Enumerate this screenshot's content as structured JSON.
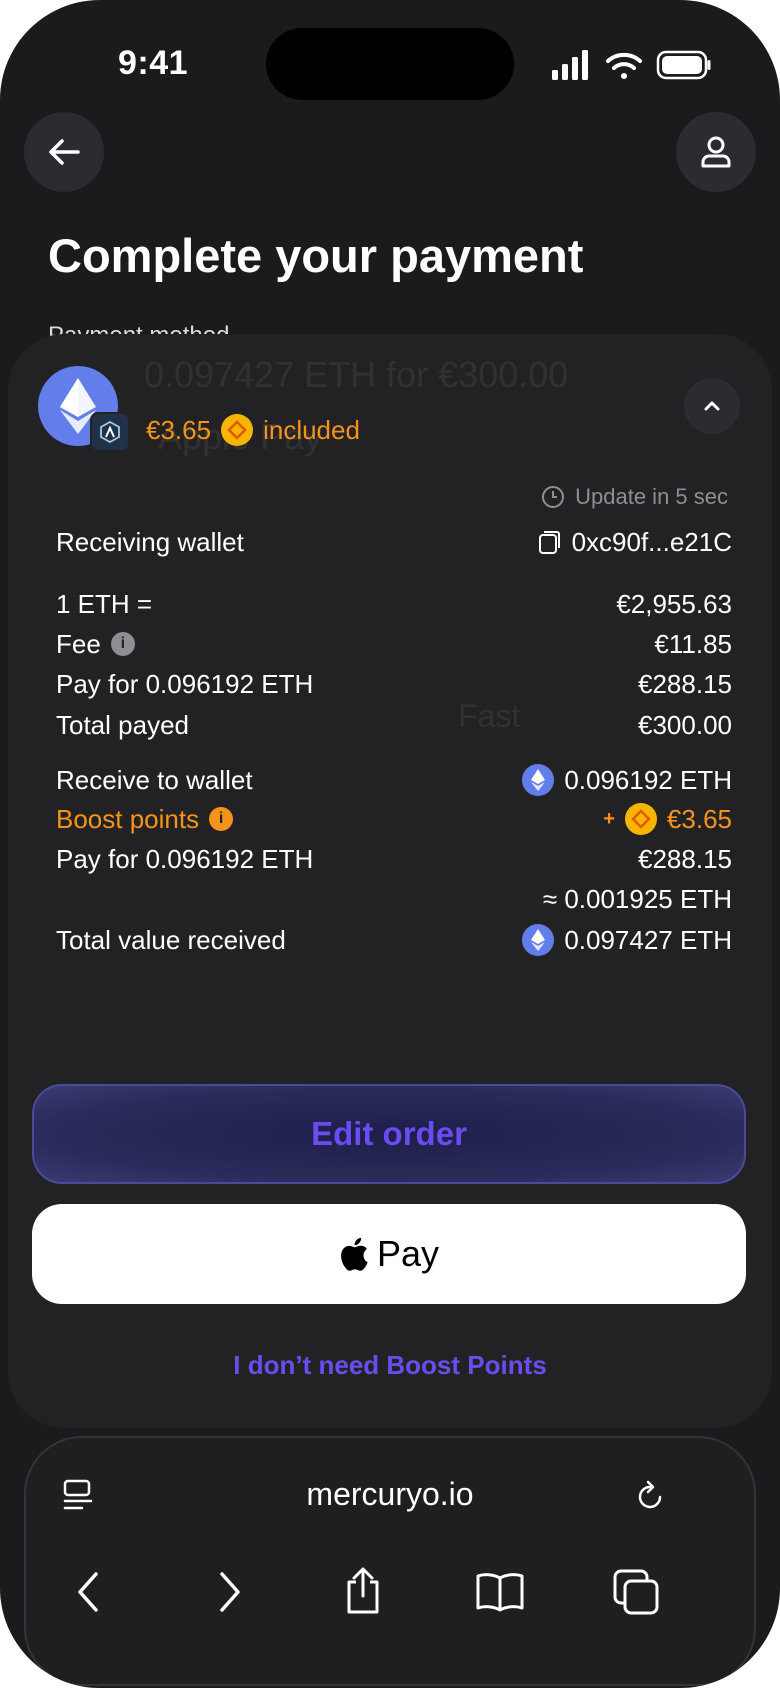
{
  "status_bar": {
    "time": "9:41"
  },
  "page": {
    "title": "Complete your payment",
    "background_label": "Payment method"
  },
  "background_ghost": {
    "line1": "0.097427 ETH for €300.00",
    "line2": "Apple Pay",
    "line3": "Fast"
  },
  "summary": {
    "boost_amount": "€3.65",
    "boost_suffix": "included",
    "update_text": "Update in 5 sec"
  },
  "details": {
    "receiving_wallet_label": "Receiving wallet",
    "receiving_wallet_value": "0xc90f...e21C",
    "rate_label": "1 ETH  =",
    "rate_value": "€2,955.63",
    "fee_label": "Fee",
    "fee_value": "€11.85",
    "pay_for_label": "Pay for 0.096192 ETH",
    "pay_for_value": "€288.15",
    "total_payed_label": "Total payed",
    "total_payed_value": "€300.00",
    "receive_label": "Receive to wallet",
    "receive_value": "0.096192 ETH",
    "boost_label": "Boost points",
    "boost_plus": "+",
    "boost_value": "€3.65",
    "pay_for2_label": "Pay for 0.096192 ETH",
    "pay_for2_value": "€288.15",
    "approx_value": "≈ 0.001925 ETH",
    "total_received_label": "Total value received",
    "total_received_value": "0.097427 ETH"
  },
  "actions": {
    "edit_order": "Edit order",
    "apple_pay": "Pay",
    "no_boost": "I don’t need Boost Points"
  },
  "browser": {
    "url": "mercuryo.io"
  },
  "colors": {
    "accent": "#6a4cf0",
    "boost": "#f7931a",
    "eth": "#627eea",
    "background": "#1b1b1e",
    "sheet": "#222225"
  }
}
